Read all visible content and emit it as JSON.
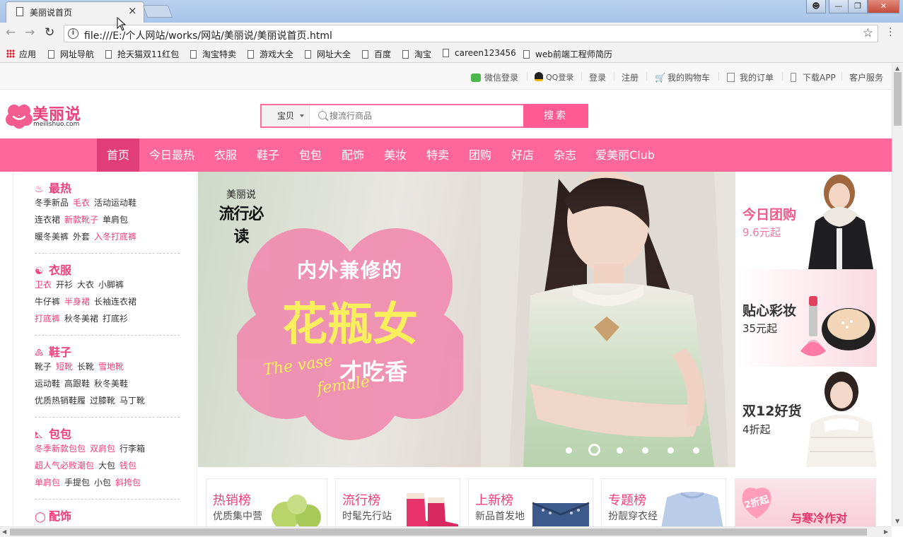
{
  "browser": {
    "tab_title": "美丽说首页",
    "url": "file:///E:/个人网站/works/网站/美丽说/美丽说首页.html",
    "bookmarks": [
      "应用",
      "网址导航",
      "抢天猫双11红包",
      "淘宝特卖",
      "游戏大全",
      "网址大全",
      "百度",
      "淘宝",
      "careen123456",
      "web前端工程师简历"
    ]
  },
  "topbar": {
    "wechat_login": "微信登录",
    "qq_login": "QQ登录",
    "login": "登录",
    "register": "注册",
    "cart": "我的购物车",
    "orders": "我的订单",
    "download": "下载APP",
    "service": "客户服务"
  },
  "logo": {
    "cn": "美丽说",
    "en": "meilishuo.com"
  },
  "search": {
    "category": "宝贝",
    "placeholder": "搜流行商品",
    "button": "搜索"
  },
  "nav": [
    "首页",
    "今日最热",
    "衣服",
    "鞋子",
    "包包",
    "配饰",
    "美妆",
    "特卖",
    "团购",
    "好店",
    "杂志",
    "爱美丽Club"
  ],
  "sidebar": [
    {
      "title": "最热",
      "rows": [
        [
          {
            "t": "冬季新品",
            "hl": false
          },
          {
            "t": "毛衣",
            "hl": true
          },
          {
            "t": "活动运动鞋",
            "hl": false
          }
        ],
        [
          {
            "t": "连衣裙",
            "hl": false
          },
          {
            "t": "新款靴子",
            "hl": true
          },
          {
            "t": "单肩包",
            "hl": false
          }
        ],
        [
          {
            "t": "暖冬美裤",
            "hl": false
          },
          {
            "t": "外套",
            "hl": false
          },
          {
            "t": "入冬打底裤",
            "hl": true
          }
        ]
      ]
    },
    {
      "title": "衣服",
      "rows": [
        [
          {
            "t": "卫衣",
            "hl": true
          },
          {
            "t": "开衫",
            "hl": false
          },
          {
            "t": "大衣",
            "hl": false
          },
          {
            "t": "小脚裤",
            "hl": false
          }
        ],
        [
          {
            "t": "牛仔裤",
            "hl": false
          },
          {
            "t": "半身裙",
            "hl": true
          },
          {
            "t": "长袖连衣裙",
            "hl": false
          }
        ],
        [
          {
            "t": "打底裤",
            "hl": true
          },
          {
            "t": "秋冬美裙",
            "hl": false
          },
          {
            "t": "打底衫",
            "hl": false
          }
        ]
      ]
    },
    {
      "title": "鞋子",
      "rows": [
        [
          {
            "t": "靴子",
            "hl": false
          },
          {
            "t": "短靴",
            "hl": true
          },
          {
            "t": "长靴",
            "hl": false
          },
          {
            "t": "雪地靴",
            "hl": true
          }
        ],
        [
          {
            "t": "运动鞋",
            "hl": false
          },
          {
            "t": "高跟鞋",
            "hl": false
          },
          {
            "t": "秋冬美鞋",
            "hl": false
          }
        ],
        [
          {
            "t": "优质热销鞋履",
            "hl": false
          },
          {
            "t": "过膝靴",
            "hl": false
          },
          {
            "t": "马丁靴",
            "hl": false
          }
        ]
      ]
    },
    {
      "title": "包包",
      "rows": [
        [
          {
            "t": "冬季新款包包",
            "hl": true
          },
          {
            "t": "双肩包",
            "hl": true
          },
          {
            "t": "行李箱",
            "hl": false
          }
        ],
        [
          {
            "t": "超人气必败潮包",
            "hl": true
          },
          {
            "t": "大包",
            "hl": false
          },
          {
            "t": "钱包",
            "hl": true
          }
        ],
        [
          {
            "t": "单肩包",
            "hl": true
          },
          {
            "t": "手提包",
            "hl": false
          },
          {
            "t": "小包",
            "hl": false
          },
          {
            "t": "斜挎包",
            "hl": true
          }
        ]
      ]
    },
    {
      "title": "配饰",
      "rows": []
    }
  ],
  "banner": {
    "brand": "美丽说",
    "tag": "流行必读",
    "line1": "内外兼修的",
    "line2": "花瓶女",
    "line3": "才吃香",
    "english1": "The vase",
    "english2": "female",
    "slides": 6,
    "active_slide": 2
  },
  "promos": [
    {
      "title": "今日团购",
      "sub": "9.6元起",
      "title_color": "#c0392b",
      "sub_color": "#c0392b"
    },
    {
      "title": "贴心彩妆",
      "sub": "35元起",
      "title_color": "#ee5b8a",
      "sub_color": "#ee7aa0"
    },
    {
      "title": "双12好货",
      "sub": "4折起",
      "title_color": "#333333",
      "sub_color": "#666666"
    }
  ],
  "ranks": [
    {
      "title": "热销榜",
      "sub": "优质集中营"
    },
    {
      "title": "流行榜",
      "sub": "时髦先行站"
    },
    {
      "title": "上新榜",
      "sub": "新品首发地"
    },
    {
      "title": "专题榜",
      "sub": "扮靓穿衣经"
    }
  ],
  "ad": {
    "badge": "2折起",
    "text": "与寒冷作对"
  },
  "colors": {
    "brand_pink": "#ff6699",
    "nav_active": "#e13d79",
    "link_pink": "#ee3e7b"
  }
}
